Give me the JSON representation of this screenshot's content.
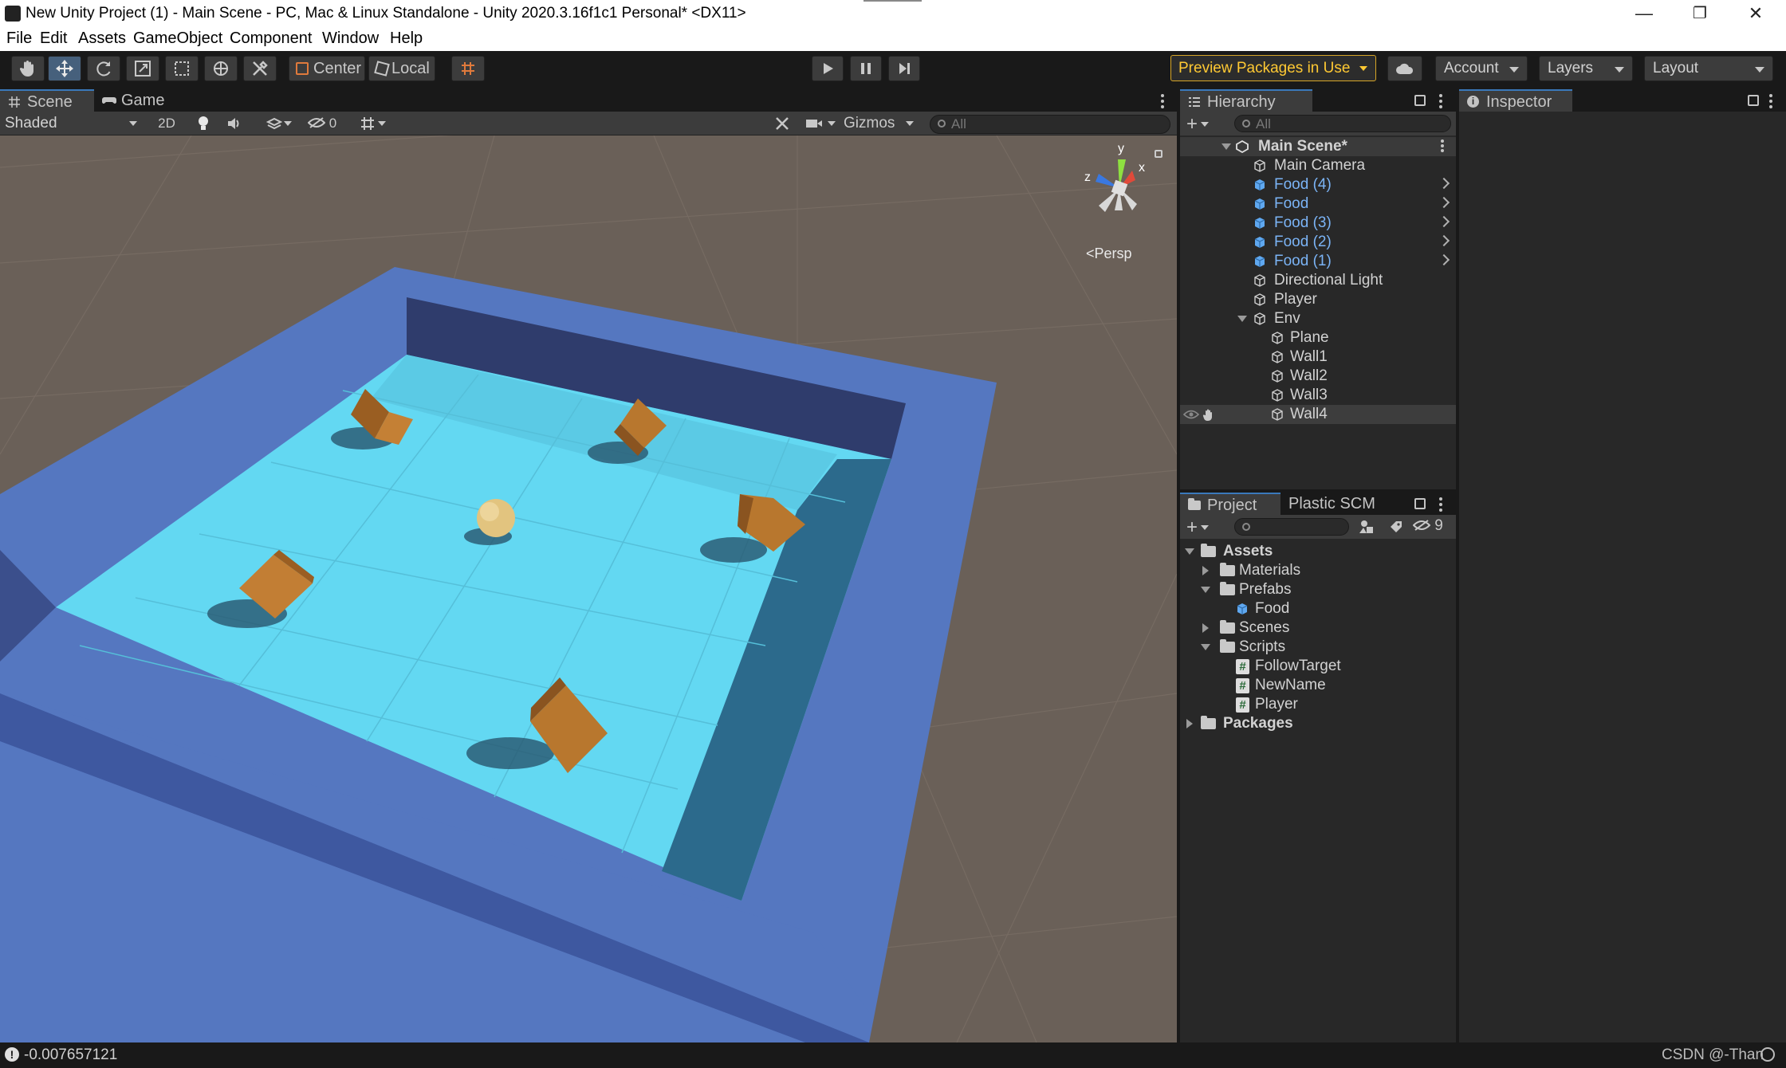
{
  "window": {
    "title": "New Unity Project (1) - Main Scene - PC, Mac & Linux Standalone - Unity 2020.3.16f1c1 Personal* <DX11>",
    "minimize": "—",
    "restore": "❐",
    "close": "✕"
  },
  "menu": [
    "File",
    "Edit",
    "Assets",
    "GameObject",
    "Component",
    "Window",
    "Help"
  ],
  "toolbar": {
    "pivot_label": "Center",
    "space_label": "Local",
    "preview_packages": "Preview Packages in Use",
    "account": "Account",
    "layers": "Layers",
    "layout": "Layout"
  },
  "scene": {
    "tabs": [
      "Scene",
      "Game"
    ],
    "shading": "Shaded",
    "mode_2d": "2D",
    "hidden_count": "0",
    "gizmos": "Gizmos",
    "search_placeholder": "All",
    "axis_y": "y",
    "axis_x": "x",
    "axis_z": "z",
    "projection": "Persp"
  },
  "hierarchy": {
    "tab": "Hierarchy",
    "search_placeholder": "All",
    "scene_name": "Main Scene*",
    "items": [
      {
        "label": "Main Camera",
        "prefab": false
      },
      {
        "label": "Food (4)",
        "prefab": true
      },
      {
        "label": "Food",
        "prefab": true
      },
      {
        "label": "Food (3)",
        "prefab": true
      },
      {
        "label": "Food (2)",
        "prefab": true
      },
      {
        "label": "Food (1)",
        "prefab": true
      },
      {
        "label": "Directional Light",
        "prefab": false
      },
      {
        "label": "Player",
        "prefab": false
      },
      {
        "label": "Env",
        "prefab": false
      }
    ],
    "env_children": [
      "Plane",
      "Wall1",
      "Wall2",
      "Wall3",
      "Wall4"
    ]
  },
  "project": {
    "tabs": [
      "Project",
      "Plastic SCM"
    ],
    "hidden_count": "9",
    "tree": {
      "assets": "Assets",
      "materials": "Materials",
      "prefabs": "Prefabs",
      "prefab_food": "Food",
      "scenes": "Scenes",
      "scripts": "Scripts",
      "script_items": [
        "FollowTarget",
        "NewName",
        "Player"
      ],
      "packages": "Packages"
    }
  },
  "inspector": {
    "tab": "Inspector"
  },
  "status": {
    "message": "-0.007657121",
    "watermark": "CSDN @-Than"
  },
  "colors": {
    "accent_blue": "#3a79bb",
    "prefab_blue": "#7bb4f6",
    "preview_yellow": "#ffc933",
    "wall_blue": "#5577c0",
    "floor_cyan": "#62d6f0",
    "food_orange": "#b9772f"
  }
}
